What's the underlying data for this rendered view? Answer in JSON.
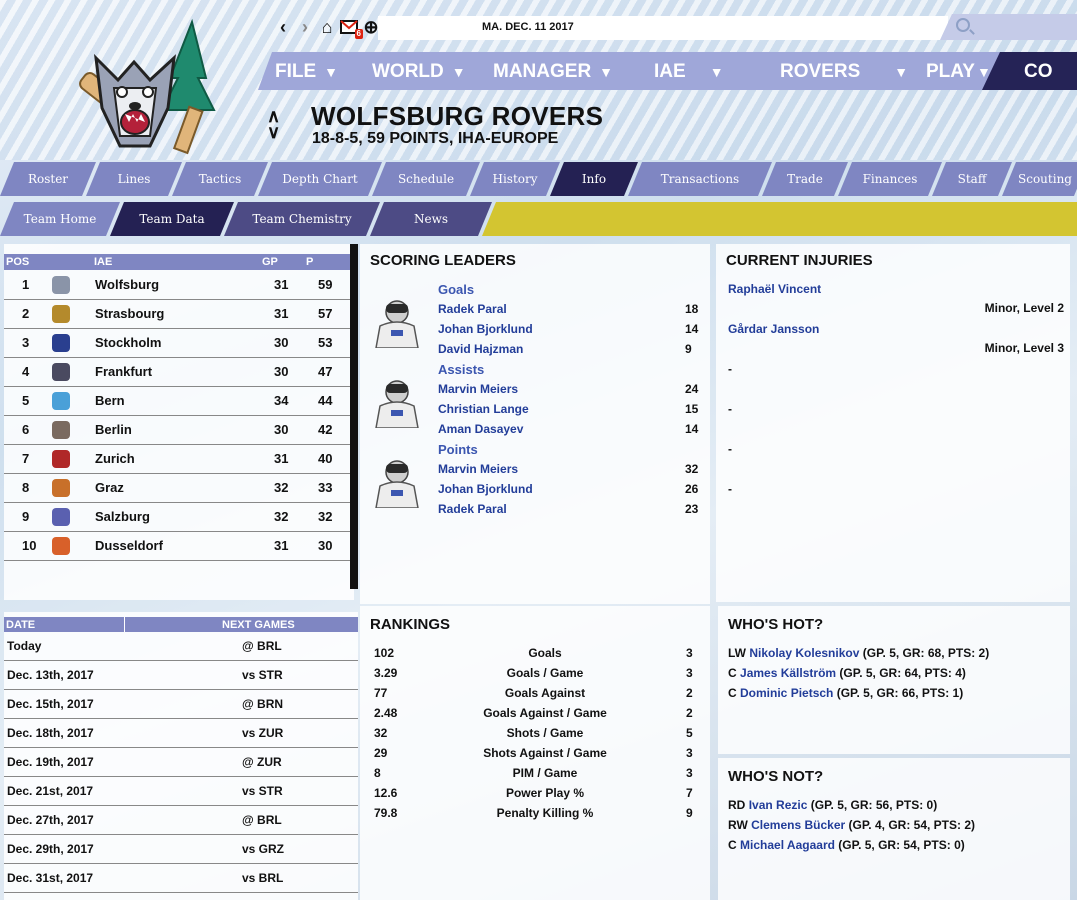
{
  "header": {
    "date": "MA. DEC. 11 2017",
    "mail_count": "6",
    "team_name": "WOLFSBURG ROVERS",
    "team_record": "18-8-5, 59 POINTS, IHA-EUROPE",
    "icons": [
      "back-arrow",
      "forward-arrow",
      "home-icon",
      "mail-icon",
      "globe-icon",
      "search-icon"
    ]
  },
  "main_menu": [
    {
      "label": "FILE"
    },
    {
      "label": "WORLD"
    },
    {
      "label": "MANAGER"
    },
    {
      "label": "IAE"
    },
    {
      "label": "ROVERS"
    },
    {
      "label": "PLAY"
    },
    {
      "label": "CO"
    }
  ],
  "tabs_primary": [
    "Roster",
    "Lines",
    "Tactics",
    "Depth Chart",
    "Schedule",
    "History",
    "Info",
    "Transactions",
    "Trade",
    "Finances",
    "Staff",
    "Scouting"
  ],
  "tabs_secondary": [
    "Team Home",
    "Team Data",
    "Team Chemistry",
    "News"
  ],
  "standings": {
    "headers": {
      "pos": "POS",
      "league": "IAE",
      "gp": "GP",
      "p": "P"
    },
    "rows": [
      {
        "pos": "1",
        "team": "Wolfsburg",
        "gp": "31",
        "p": "59",
        "color": "#8a94a8"
      },
      {
        "pos": "2",
        "team": "Strasbourg",
        "gp": "31",
        "p": "57",
        "color": "#b48a2c"
      },
      {
        "pos": "3",
        "team": "Stockholm",
        "gp": "30",
        "p": "53",
        "color": "#2a3f8f"
      },
      {
        "pos": "4",
        "team": "Frankfurt",
        "gp": "30",
        "p": "47",
        "color": "#4a4a60"
      },
      {
        "pos": "5",
        "team": "Bern",
        "gp": "34",
        "p": "44",
        "color": "#4aa0d8"
      },
      {
        "pos": "6",
        "team": "Berlin",
        "gp": "30",
        "p": "42",
        "color": "#7a6a60"
      },
      {
        "pos": "7",
        "team": "Zurich",
        "gp": "31",
        "p": "40",
        "color": "#b02828"
      },
      {
        "pos": "8",
        "team": "Graz",
        "gp": "32",
        "p": "33",
        "color": "#c8702a"
      },
      {
        "pos": "9",
        "team": "Salzburg",
        "gp": "32",
        "p": "32",
        "color": "#5a60b0"
      },
      {
        "pos": "10",
        "team": "Dusseldorf",
        "gp": "31",
        "p": "30",
        "color": "#d8602a"
      }
    ]
  },
  "scoring_leaders": {
    "title": "SCORING LEADERS",
    "categories": [
      {
        "name": "Goals",
        "players": [
          {
            "name": "Radek Paral",
            "value": "18"
          },
          {
            "name": "Johan Bjorklund",
            "value": "14"
          },
          {
            "name": "David Hajzman",
            "value": "9"
          }
        ]
      },
      {
        "name": "Assists",
        "players": [
          {
            "name": "Marvin Meiers",
            "value": "24"
          },
          {
            "name": "Christian Lange",
            "value": "15"
          },
          {
            "name": "Aman Dasayev",
            "value": "14"
          }
        ]
      },
      {
        "name": "Points",
        "players": [
          {
            "name": "Marvin Meiers",
            "value": "32"
          },
          {
            "name": "Johan Bjorklund",
            "value": "26"
          },
          {
            "name": "Radek Paral",
            "value": "23"
          }
        ]
      }
    ]
  },
  "injuries": {
    "title": "CURRENT INJURIES",
    "items": [
      {
        "name": "Raphaël Vincent",
        "level": "Minor, Level 2"
      },
      {
        "name": "Gårdar Jansson",
        "level": "Minor, Level 3"
      }
    ],
    "empty": [
      "-",
      "-",
      "-",
      "-"
    ]
  },
  "next_games": {
    "headers": {
      "date": "DATE",
      "next": "NEXT GAMES"
    },
    "rows": [
      {
        "date": "Today",
        "opp": "@ BRL"
      },
      {
        "date": "Dec. 13th, 2017",
        "opp": "vs STR"
      },
      {
        "date": "Dec. 15th, 2017",
        "opp": "@ BRN"
      },
      {
        "date": "Dec. 18th, 2017",
        "opp": "vs ZUR"
      },
      {
        "date": "Dec. 19th, 2017",
        "opp": "@ ZUR"
      },
      {
        "date": "Dec. 21st, 2017",
        "opp": "vs STR"
      },
      {
        "date": "Dec. 27th, 2017",
        "opp": "@ BRL"
      },
      {
        "date": "Dec. 29th, 2017",
        "opp": "vs GRZ"
      },
      {
        "date": "Dec. 31st, 2017",
        "opp": "vs BRL"
      }
    ]
  },
  "rankings": {
    "title": "RANKINGS",
    "rows": [
      {
        "value": "102",
        "label": "Goals",
        "rank": "3"
      },
      {
        "value": "3.29",
        "label": "Goals / Game",
        "rank": "3"
      },
      {
        "value": "77",
        "label": "Goals Against",
        "rank": "2"
      },
      {
        "value": "2.48",
        "label": "Goals Against / Game",
        "rank": "2"
      },
      {
        "value": "32",
        "label": "Shots / Game",
        "rank": "5"
      },
      {
        "value": "29",
        "label": "Shots Against / Game",
        "rank": "3"
      },
      {
        "value": "8",
        "label": "PIM / Game",
        "rank": "3"
      },
      {
        "value": "12.6",
        "label": "Power Play %",
        "rank": "7"
      },
      {
        "value": "79.8",
        "label": "Penalty Killing %",
        "rank": "9"
      }
    ]
  },
  "whos_hot": {
    "title": "WHO'S HOT?",
    "players": [
      {
        "pos": "LW",
        "name": "Nikolay Kolesnikov",
        "stats": "(GP. 5, GR: 68, PTS: 2)"
      },
      {
        "pos": "C",
        "name": "James Källström",
        "stats": "(GP. 5, GR: 64, PTS: 4)"
      },
      {
        "pos": "C",
        "name": "Dominic Pietsch",
        "stats": "(GP. 5, GR: 66, PTS: 1)"
      }
    ]
  },
  "whos_not": {
    "title": "WHO'S NOT?",
    "players": [
      {
        "pos": "RD",
        "name": "Ivan Rezic",
        "stats": "(GP. 5, GR: 56, PTS: 0)"
      },
      {
        "pos": "RW",
        "name": "Clemens Bücker",
        "stats": "(GP. 4, GR: 54, PTS: 2)"
      },
      {
        "pos": "C",
        "name": "Michael Aagaard",
        "stats": "(GP. 5, GR: 54, PTS: 0)"
      }
    ]
  },
  "colors": {
    "menu_bg": "#9fa7d9",
    "tab_bg": "#7f86c2",
    "tab_active": "#242153",
    "accent_bar": "#d3c531",
    "link": "#223d99"
  }
}
